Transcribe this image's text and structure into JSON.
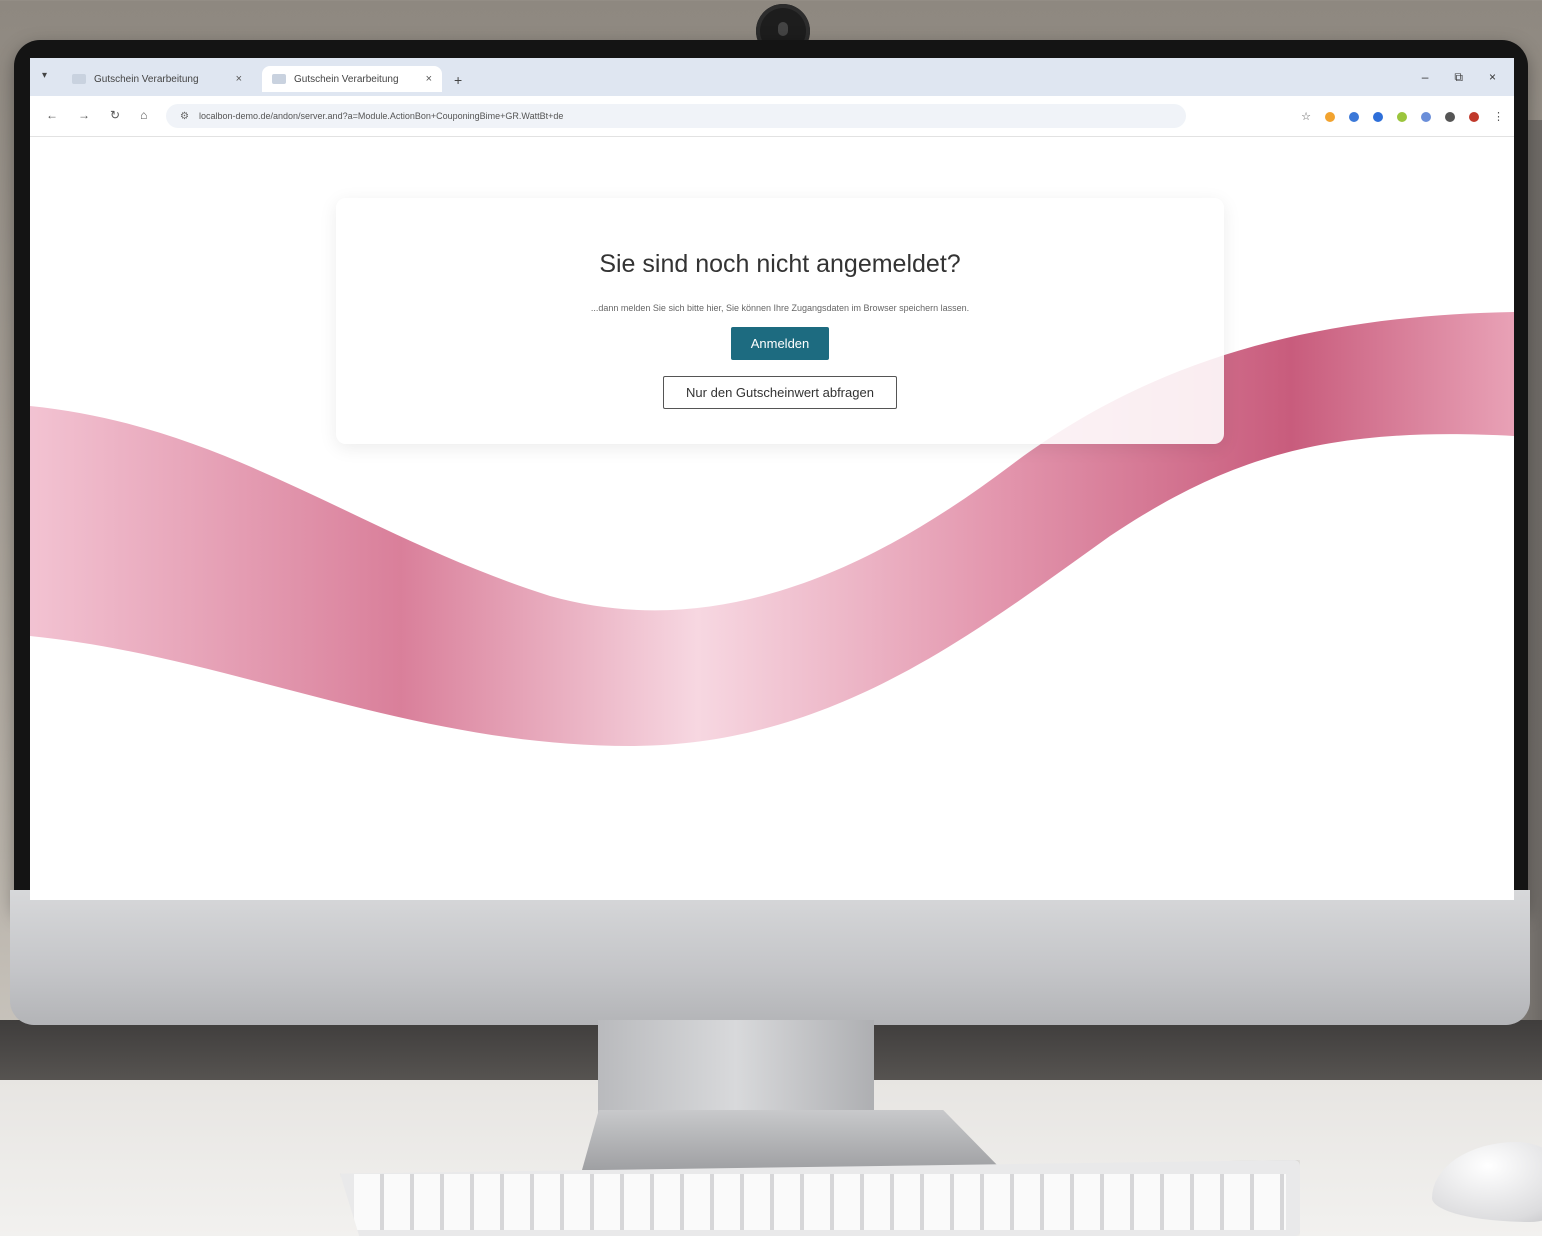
{
  "browser": {
    "tabs": [
      {
        "title": "Gutschein Verarbeitung",
        "close": "×"
      },
      {
        "title": "Gutschein Verarbeitung",
        "close": "×"
      }
    ],
    "tab_menu": "▾",
    "new_tab": "+",
    "window_controls": {
      "minimize": "–",
      "restore": "⧉",
      "close": "×"
    },
    "nav": {
      "back": "←",
      "forward": "→",
      "reload": "↻",
      "home": "⌂"
    },
    "url": "localbon-demo.de/andon/server.and?a=Module.ActionBon+CouponingBime+GR.WattBt+de",
    "extension_colors": [
      "#f2a32f",
      "#3b78d8",
      "#2e6fd9",
      "#9bc53d",
      "#6a8ed9",
      "#555555",
      "#c0392b"
    ]
  },
  "login": {
    "title": "Sie sind noch nicht angemeldet?",
    "description": "...dann melden Sie sich bitte hier, Sie können Ihre Zugangsdaten im Browser speichern lassen.",
    "login_button": "Anmelden",
    "voucher_button": "Nur den Gutscheinwert abfragen"
  },
  "colors": {
    "primary_button": "#1d6b80",
    "ribbon": "#d46a8a"
  }
}
